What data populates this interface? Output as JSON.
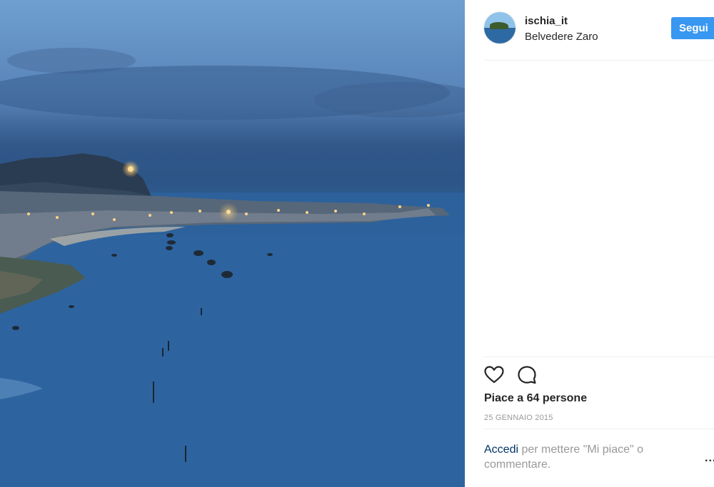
{
  "post": {
    "username": "ischia_it",
    "location": "Belvedere Zaro",
    "follow_label": "Segui",
    "likes_text": "Piace a 64 persone",
    "date": "25 GENNAIO 2015",
    "login_link": "Accedi",
    "login_rest": " per mettere \"Mi piace\" o commentare.",
    "more_label": "..."
  },
  "icons": {
    "like": "heart-outline-icon",
    "comment": "speech-bubble-icon"
  },
  "colors": {
    "follow_button": "#3897f0",
    "text": "#262626",
    "muted": "#999999",
    "link": "#003569"
  }
}
